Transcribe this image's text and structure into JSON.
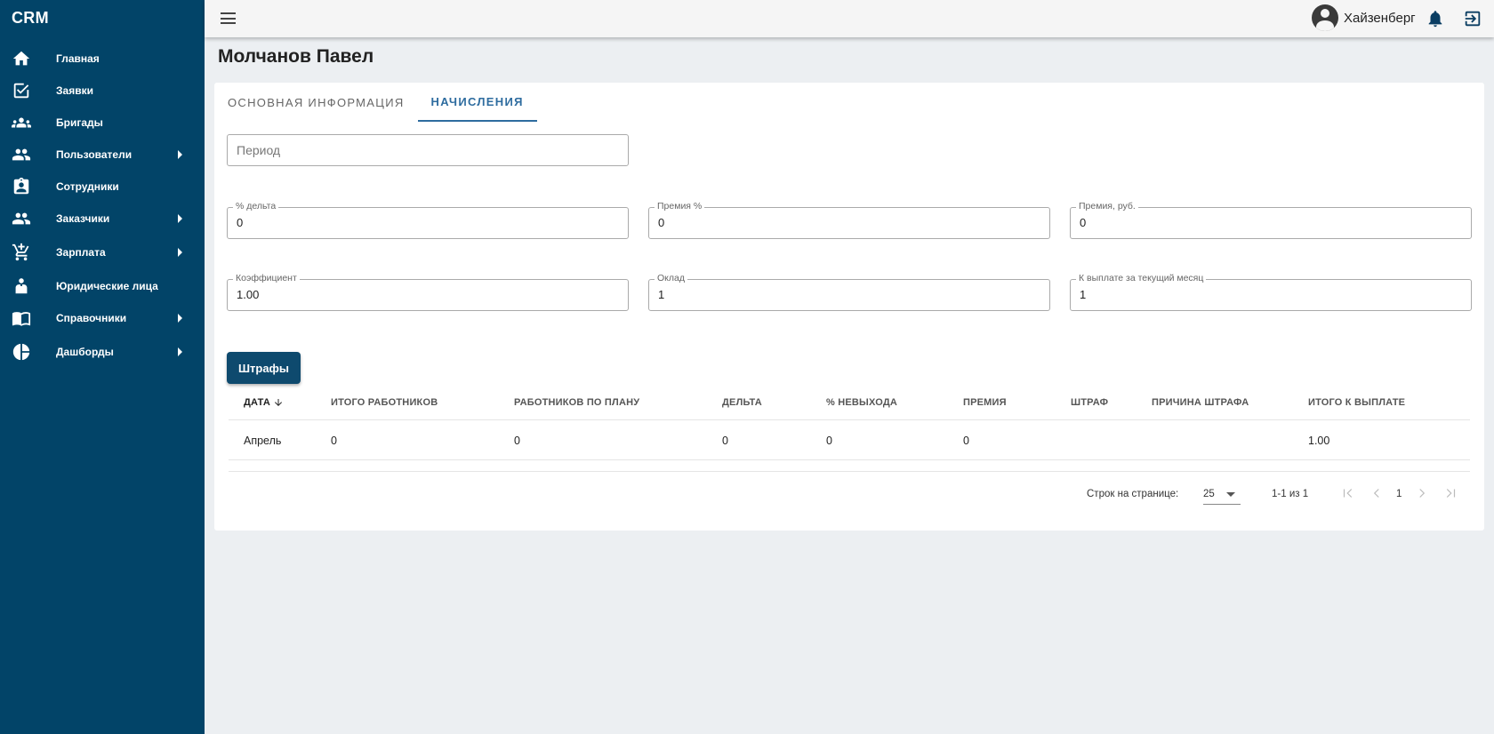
{
  "app": {
    "brand": "CRM"
  },
  "sidebar": {
    "items": [
      {
        "label": "Главная",
        "icon": "home-icon",
        "arrow": false
      },
      {
        "label": "Заявки",
        "icon": "checkbox-icon",
        "arrow": false
      },
      {
        "label": "Бригады",
        "icon": "groups-icon",
        "arrow": false
      },
      {
        "label": "Пользователи",
        "icon": "people-icon",
        "arrow": true
      },
      {
        "label": "Сотрудники",
        "icon": "clipboard-user-icon",
        "arrow": false
      },
      {
        "label": "Заказчики",
        "icon": "people-icon",
        "arrow": true
      },
      {
        "label": "Зарплата",
        "icon": "cart-icon",
        "arrow": true
      },
      {
        "label": "Юридические лица",
        "icon": "person-icon",
        "arrow": false
      },
      {
        "label": "Справочники",
        "icon": "book-icon",
        "arrow": true
      },
      {
        "label": "Дашборды",
        "icon": "pie-chart-icon",
        "arrow": true
      }
    ]
  },
  "topbar": {
    "username": "Хайзенберг"
  },
  "page": {
    "title": "Молчанов Павел"
  },
  "tabs": [
    {
      "label": "ОСНОВНАЯ ИНФОРМАЦИЯ",
      "active": false
    },
    {
      "label": "НАЧИСЛЕНИЯ",
      "active": true
    }
  ],
  "form": {
    "period_placeholder": "Период",
    "delta_label": "% дельта",
    "delta_value": "0",
    "bonus_pct_label": "Премия %",
    "bonus_pct_value": "0",
    "bonus_rub_label": "Премия, руб.",
    "bonus_rub_value": "0",
    "coef_label": "Коэффициент",
    "coef_value": "1.00",
    "salary_label": "Оклад",
    "salary_value": "1",
    "payout_label": "К выплате за текущий месяц",
    "payout_value": "1"
  },
  "actions": {
    "fines_label": "Штрафы"
  },
  "table": {
    "columns": [
      "ДАТА",
      "ИТОГО РАБОТНИКОВ",
      "РАБОТНИКОВ ПО ПЛАНУ",
      "ДЕЛЬТА",
      "% НЕВЫХОДА",
      "ПРЕМИЯ",
      "ШТРАФ",
      "ПРИЧИНА ШТРАФА",
      "ИТОГО К ВЫПЛАТЕ"
    ],
    "rows": [
      [
        "Апрель",
        "0",
        "0",
        "0",
        "0",
        "0",
        "",
        "",
        "1.00"
      ]
    ]
  },
  "pagination": {
    "rows_label": "Строк на странице:",
    "rows_per_page": "25",
    "range": "1-1 из 1",
    "page": "1"
  },
  "colors": {
    "sidebar": "#024468",
    "accent": "#2e6c9f",
    "button": "#0e4a6e"
  }
}
